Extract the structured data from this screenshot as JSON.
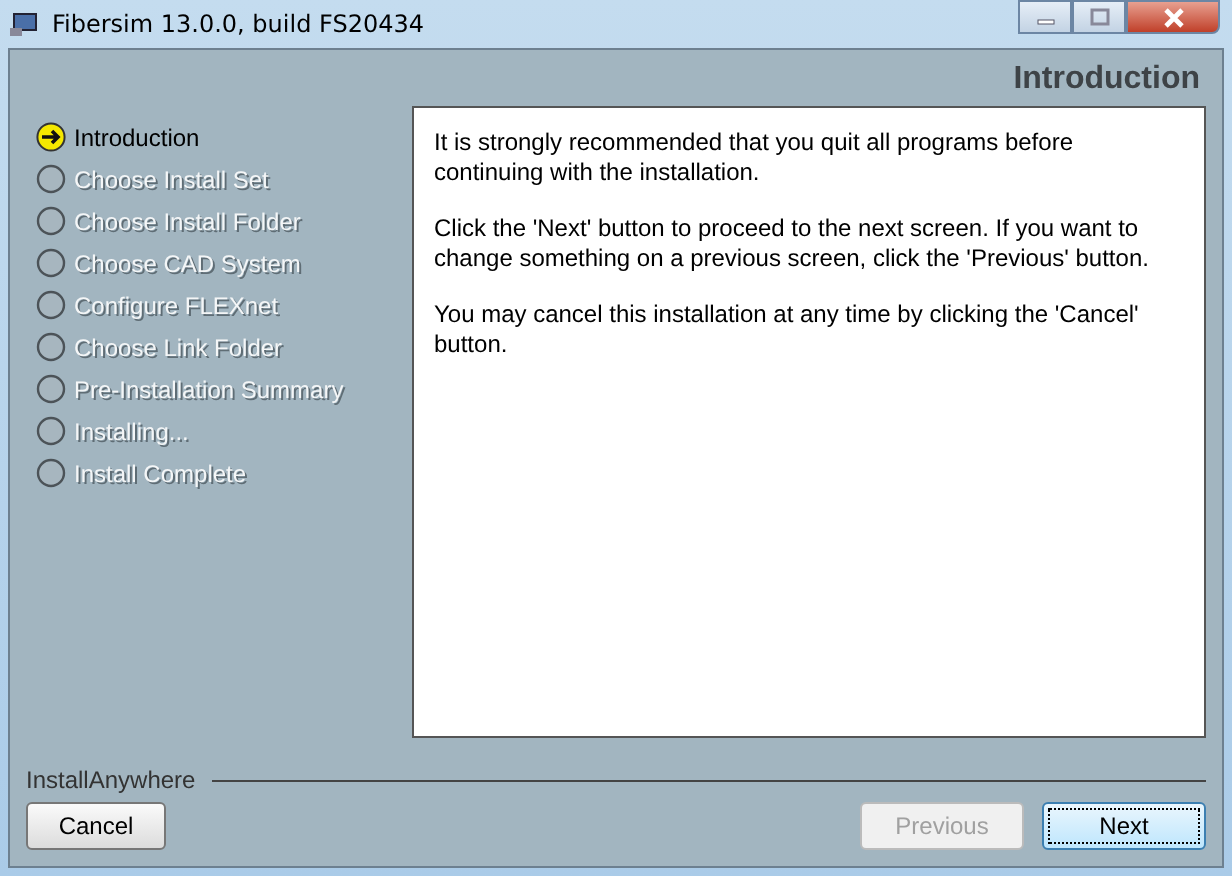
{
  "window": {
    "title": "Fibersim 13.0.0, build FS20434"
  },
  "header": {
    "title": "Introduction"
  },
  "steps": [
    {
      "label": "Introduction",
      "selected": true
    },
    {
      "label": "Choose Install Set",
      "selected": false
    },
    {
      "label": "Choose Install Folder",
      "selected": false
    },
    {
      "label": "Choose CAD System",
      "selected": false
    },
    {
      "label": "Configure FLEXnet",
      "selected": false
    },
    {
      "label": "Choose Link Folder",
      "selected": false
    },
    {
      "label": "Pre-Installation Summary",
      "selected": false
    },
    {
      "label": "Installing...",
      "selected": false
    },
    {
      "label": "Install Complete",
      "selected": false
    }
  ],
  "content": {
    "paragraphs": [
      "It is strongly recommended that you quit all programs before continuing with the installation.",
      "Click the 'Next' button to proceed to the next screen. If you want to change something on a previous screen, click the 'Previous' button.",
      "You may cancel this installation at any time by clicking the 'Cancel' button."
    ]
  },
  "footer": {
    "brand": "InstallAnywhere"
  },
  "buttons": [
    {
      "label": "Cancel",
      "disabled": false
    },
    {
      "label": "Previous",
      "disabled": true
    },
    {
      "label": "Next",
      "disabled": false
    }
  ]
}
